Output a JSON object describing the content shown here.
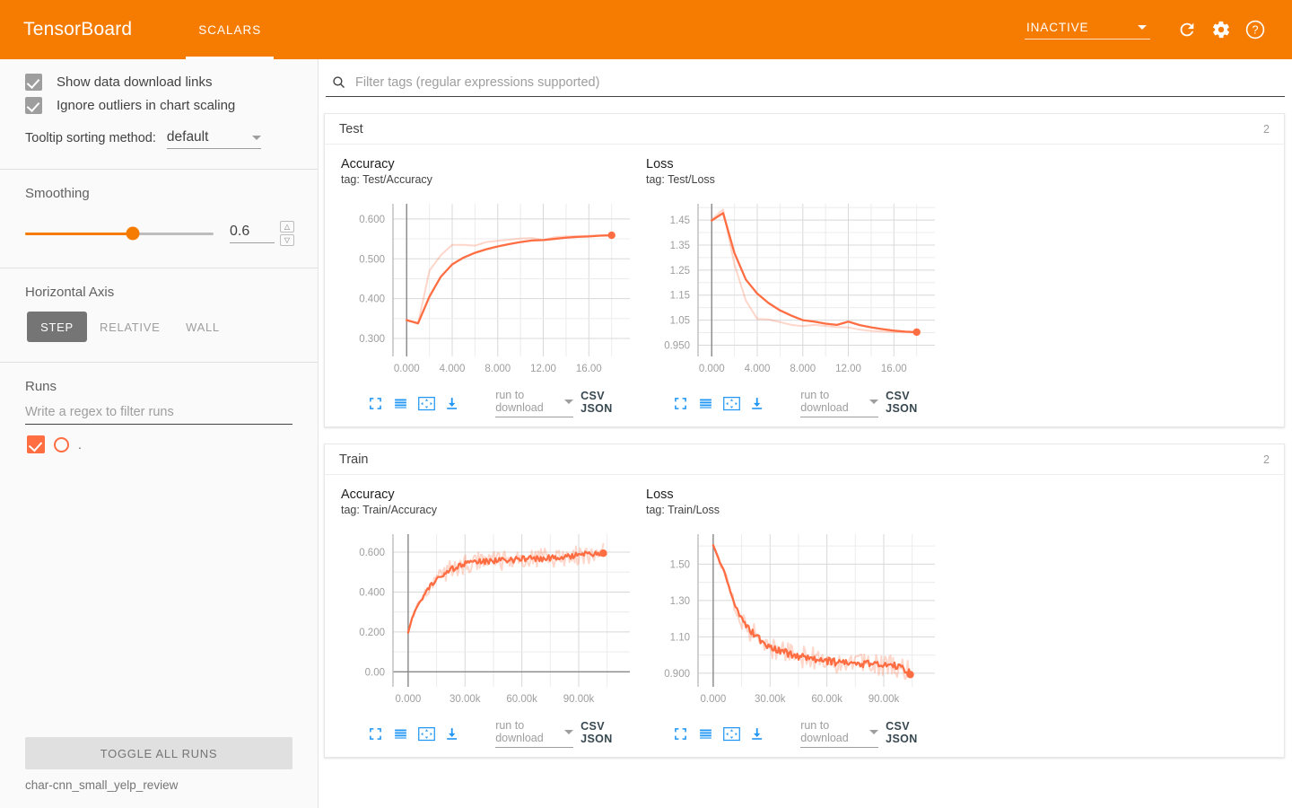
{
  "header": {
    "brand": "TensorBoard",
    "tabs": [
      {
        "label": "SCALARS",
        "active": true
      }
    ],
    "status": {
      "label": "INACTIVE"
    },
    "icons": {
      "refresh": "refresh-icon",
      "settings": "gear-icon",
      "help": "help-icon"
    },
    "accent_color": "#f57c00"
  },
  "sidebar": {
    "checkboxes": [
      {
        "label": "Show data download links",
        "checked": true
      },
      {
        "label": "Ignore outliers in chart scaling",
        "checked": true
      }
    ],
    "tooltip_sorting": {
      "label": "Tooltip sorting method:",
      "value": "default"
    },
    "smoothing": {
      "title": "Smoothing",
      "value": "0.6",
      "percent": 57
    },
    "horizontal_axis": {
      "title": "Horizontal Axis",
      "options": [
        {
          "label": "STEP",
          "selected": true
        },
        {
          "label": "RELATIVE",
          "selected": false
        },
        {
          "label": "WALL",
          "selected": false
        }
      ]
    },
    "runs": {
      "title": "Runs",
      "filter_placeholder": "Write a regex to filter runs",
      "items": [
        {
          "label": ".",
          "checked": true,
          "color": "#ff6d42"
        }
      ],
      "toggle_all_label": "TOGGLE ALL RUNS",
      "run_name": "char-cnn_small_yelp_review"
    }
  },
  "main": {
    "filter_placeholder": "Filter tags (regular expressions supported)",
    "sections": [
      {
        "title": "Test",
        "count": "2"
      },
      {
        "title": "Train",
        "count": "2"
      }
    ],
    "chart_tools": {
      "expand": "expand-icon",
      "data_table": "data-table-icon",
      "fit_domain": "fit-domain-icon",
      "download": "download-icon",
      "run_select_placeholder": "run to download",
      "csv_label": "CSV",
      "json_label": "JSON",
      "csvjson_label": "CSV JSON"
    }
  },
  "chart_data": [
    {
      "type": "line",
      "title": "Accuracy",
      "tag": "tag: Test/Accuracy",
      "section": "Test",
      "xlabel": "",
      "ylabel": "",
      "grid": true,
      "legend": "none",
      "color": "#ff6d42",
      "xticks": [
        "0.000",
        "4.000",
        "8.000",
        "12.00",
        "16.00"
      ],
      "xtickvals": [
        0,
        4,
        8,
        12,
        16
      ],
      "yticks": [
        "0.300",
        "0.400",
        "0.500",
        "0.600"
      ],
      "ytickvals": [
        0.3,
        0.4,
        0.5,
        0.6
      ],
      "xlim": [
        -1.2,
        19.6
      ],
      "ylim": [
        0.255,
        0.638
      ],
      "endpoint_marker": true,
      "series": [
        {
          "name": "smoothed",
          "opacity": 1,
          "x": [
            0,
            1,
            2,
            3,
            4,
            5,
            6,
            7,
            8,
            9,
            10,
            11,
            12,
            13,
            14,
            15,
            16,
            17,
            18
          ],
          "y": [
            0.346,
            0.338,
            0.405,
            0.455,
            0.486,
            0.503,
            0.515,
            0.524,
            0.531,
            0.537,
            0.542,
            0.546,
            0.547,
            0.55,
            0.553,
            0.555,
            0.556,
            0.558,
            0.559
          ]
        },
        {
          "name": "raw",
          "opacity": 0.28,
          "x": [
            0,
            1,
            2,
            3,
            4,
            5,
            6,
            7,
            8,
            9,
            10,
            11,
            12,
            13,
            14,
            15,
            16,
            17,
            18
          ],
          "y": [
            0.347,
            0.337,
            0.47,
            0.509,
            0.535,
            0.535,
            0.533,
            0.542,
            0.545,
            0.548,
            0.551,
            0.552,
            0.547,
            0.554,
            0.556,
            0.557,
            0.558,
            0.559,
            0.56
          ]
        }
      ]
    },
    {
      "type": "line",
      "title": "Loss",
      "tag": "tag: Test/Loss",
      "section": "Test",
      "xlabel": "",
      "ylabel": "",
      "grid": true,
      "legend": "none",
      "color": "#ff6d42",
      "xticks": [
        "0.000",
        "4.000",
        "8.000",
        "12.00",
        "16.00"
      ],
      "xtickvals": [
        0,
        4,
        8,
        12,
        16
      ],
      "yticks": [
        "0.950",
        "1.05",
        "1.15",
        "1.25",
        "1.35",
        "1.45"
      ],
      "ytickvals": [
        0.95,
        1.05,
        1.15,
        1.25,
        1.35,
        1.45
      ],
      "xlim": [
        -1.2,
        19.6
      ],
      "ylim": [
        0.905,
        1.515
      ],
      "endpoint_marker": true,
      "series": [
        {
          "name": "smoothed",
          "opacity": 1,
          "x": [
            0,
            1,
            2,
            3,
            4,
            5,
            6,
            7,
            8,
            9,
            10,
            11,
            12,
            13,
            14,
            15,
            16,
            17,
            18
          ],
          "y": [
            1.448,
            1.478,
            1.318,
            1.212,
            1.156,
            1.118,
            1.089,
            1.068,
            1.05,
            1.044,
            1.036,
            1.031,
            1.044,
            1.03,
            1.021,
            1.014,
            1.008,
            1.004,
            1.002
          ]
        },
        {
          "name": "raw",
          "opacity": 0.28,
          "x": [
            0,
            1,
            2,
            3,
            4,
            5,
            6,
            7,
            8,
            9,
            10,
            11,
            12,
            13,
            14,
            15,
            16,
            17,
            18
          ],
          "y": [
            1.452,
            1.492,
            1.272,
            1.128,
            1.055,
            1.053,
            1.042,
            1.031,
            1.026,
            1.031,
            1.027,
            1.022,
            1.021,
            1.012,
            1.007,
            1.004,
            1.002,
            1.001,
            1.0
          ]
        }
      ]
    },
    {
      "type": "line",
      "title": "Accuracy",
      "tag": "tag: Train/Accuracy",
      "section": "Train",
      "xlabel": "",
      "ylabel": "",
      "grid": true,
      "legend": "none",
      "color": "#ff6d42",
      "xticks": [
        "0.000",
        "30.00k",
        "60.00k",
        "90.00k"
      ],
      "xtickvals": [
        0,
        30000,
        60000,
        90000
      ],
      "yticks": [
        "0.00",
        "0.200",
        "0.400",
        "0.600"
      ],
      "ytickvals": [
        0.0,
        0.2,
        0.4,
        0.6
      ],
      "xlim": [
        -8000,
        117000
      ],
      "ylim": [
        -0.075,
        0.69
      ],
      "endpoint_marker": true,
      "noisy": true,
      "series": [
        {
          "name": "smoothed",
          "opacity": 1,
          "noise": 0.016,
          "x": [
            0,
            2000,
            4000,
            6000,
            8000,
            10000,
            12000,
            15000,
            18000,
            21000,
            25000,
            30000,
            35000,
            40000,
            48000,
            56000,
            64000,
            72000,
            80000,
            88000,
            96000,
            103000
          ],
          "y": [
            0.196,
            0.268,
            0.312,
            0.348,
            0.376,
            0.406,
            0.434,
            0.468,
            0.492,
            0.507,
            0.525,
            0.54,
            0.548,
            0.553,
            0.558,
            0.562,
            0.566,
            0.57,
            0.575,
            0.582,
            0.59,
            0.598
          ]
        },
        {
          "name": "raw",
          "opacity": 0.28,
          "noise": 0.048,
          "x": [
            0,
            2000,
            4000,
            6000,
            8000,
            10000,
            12000,
            15000,
            18000,
            21000,
            25000,
            30000,
            35000,
            40000,
            48000,
            56000,
            64000,
            72000,
            80000,
            88000,
            96000,
            103000
          ],
          "y": [
            0.196,
            0.268,
            0.312,
            0.348,
            0.376,
            0.406,
            0.434,
            0.468,
            0.492,
            0.507,
            0.525,
            0.54,
            0.548,
            0.553,
            0.558,
            0.562,
            0.566,
            0.57,
            0.575,
            0.582,
            0.59,
            0.598
          ]
        }
      ]
    },
    {
      "type": "line",
      "title": "Loss",
      "tag": "tag: Train/Loss",
      "section": "Train",
      "xlabel": "",
      "ylabel": "",
      "grid": true,
      "legend": "none",
      "color": "#ff6d42",
      "xticks": [
        "0.000",
        "30.00k",
        "60.00k",
        "90.00k"
      ],
      "xtickvals": [
        0,
        30000,
        60000,
        90000
      ],
      "yticks": [
        "0.900",
        "1.10",
        "1.30",
        "1.50"
      ],
      "ytickvals": [
        0.9,
        1.1,
        1.3,
        1.5
      ],
      "xlim": [
        -8000,
        117000
      ],
      "ylim": [
        0.825,
        1.665
      ],
      "endpoint_marker": true,
      "noisy": true,
      "series": [
        {
          "name": "smoothed",
          "opacity": 1,
          "noise": 0.02,
          "x": [
            0,
            2000,
            4000,
            6000,
            8000,
            10000,
            12000,
            15000,
            18000,
            22000,
            26000,
            30000,
            36000,
            42000,
            50000,
            58000,
            66000,
            74000,
            82000,
            90000,
            98000,
            104000
          ],
          "y": [
            1.605,
            1.552,
            1.498,
            1.452,
            1.39,
            1.318,
            1.258,
            1.196,
            1.15,
            1.108,
            1.072,
            1.046,
            1.022,
            1.0,
            0.984,
            0.972,
            0.958,
            0.952,
            0.948,
            0.944,
            0.938,
            0.905
          ]
        },
        {
          "name": "raw",
          "opacity": 0.28,
          "noise": 0.062,
          "x": [
            0,
            2000,
            4000,
            6000,
            8000,
            10000,
            12000,
            15000,
            18000,
            22000,
            26000,
            30000,
            36000,
            42000,
            50000,
            58000,
            66000,
            74000,
            82000,
            90000,
            98000,
            104000
          ],
          "y": [
            1.605,
            1.552,
            1.498,
            1.452,
            1.39,
            1.318,
            1.258,
            1.196,
            1.15,
            1.108,
            1.072,
            1.046,
            1.022,
            1.0,
            0.984,
            0.972,
            0.958,
            0.952,
            0.948,
            0.944,
            0.938,
            0.905
          ]
        }
      ]
    }
  ]
}
